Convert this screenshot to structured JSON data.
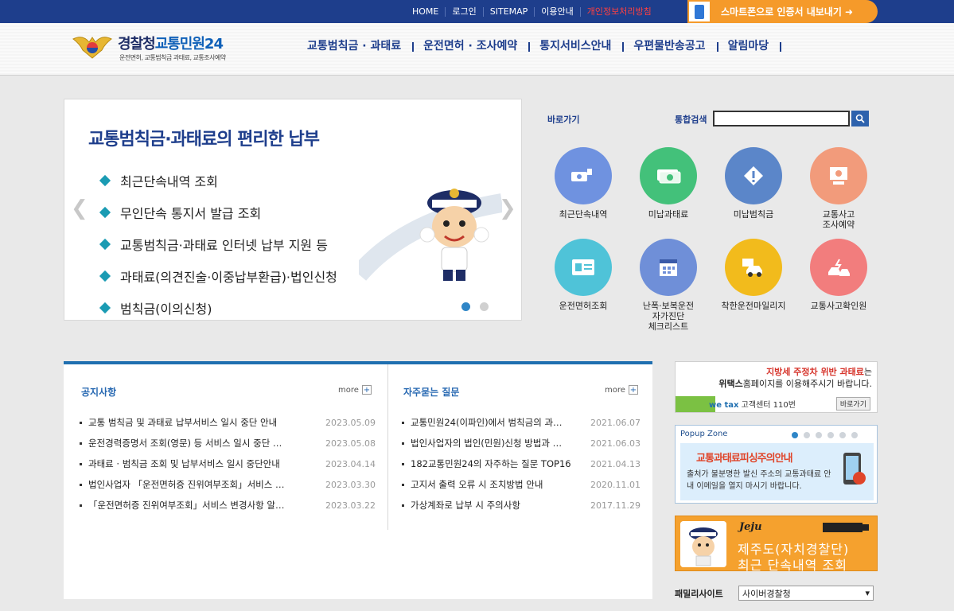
{
  "topbar": {
    "links": [
      "HOME",
      "로그인",
      "SITEMAP",
      "이용안내",
      "개인정보처리방침"
    ],
    "smart_label": "스마트폰으로 인증서 내보내기 ➜"
  },
  "logo": {
    "title_a": "경찰청",
    "title_b": "교통민원24",
    "subtitle": "운전면허, 교통범칙금 과태료, 교통조사예약"
  },
  "nav": [
    "교통범칙금 · 과태료",
    "운전면허 · 조사예약",
    "통지서비스안내",
    "우편물반송공고",
    "알림마당"
  ],
  "visual": {
    "title": "교통범칙금·과태료의 편리한 납부",
    "items": [
      "최근단속내역 조회",
      "무인단속 통지서 발급 조회",
      "교통범칙금·과태료 인터넷 납부 지원 등",
      "과태료(의견진술·이중납부환급)·법인신청",
      "범칙금(이의신청)"
    ],
    "prev_arrow": "❮",
    "next_arrow": "❯",
    "slide": "1 / 2"
  },
  "quick": {
    "title": "바로가기",
    "search_label": "통합검색",
    "search_value": "",
    "items": [
      {
        "label": "최근단속내역",
        "color": "#6f92e0",
        "icon": "camera-icon"
      },
      {
        "label": "미납과태료",
        "color": "#43c17a",
        "icon": "money-icon"
      },
      {
        "label": "미납범칙금",
        "color": "#5b86c9",
        "icon": "warning-icon"
      },
      {
        "label": "교통사고\n조사예약",
        "color": "#f29b7b",
        "icon": "monitor-icon"
      },
      {
        "label": "운전면허조회",
        "color": "#4fc3d8",
        "icon": "license-icon"
      },
      {
        "label": "난폭·보복운전\n자가진단\n체크리스트",
        "color": "#6f8fd8",
        "icon": "calendar-icon"
      },
      {
        "label": "착한운전마일리지",
        "color": "#f2bb1c",
        "icon": "car-icon"
      },
      {
        "label": "교통사고확인원",
        "color": "#f27d7d",
        "icon": "crash-icon"
      }
    ]
  },
  "notice": {
    "title": "공지사항",
    "more": "more",
    "items": [
      {
        "title": "교통 범칙금 및 과태료 납부서비스 일시 중단 안내",
        "date": "2023.05.09"
      },
      {
        "title": "운전경력증명서 조회(영문) 등 서비스 일시 중단 …",
        "date": "2023.05.08"
      },
      {
        "title": "과태료 · 범칙금 조회 및 납부서비스 일시 중단안내",
        "date": "2023.04.14"
      },
      {
        "title": "법인사업자 「운전면허증 진위여부조회」서비스 …",
        "date": "2023.03.30"
      },
      {
        "title": "「운전면허증 진위여부조회」서비스 변경사항 알…",
        "date": "2023.03.22"
      }
    ]
  },
  "faq": {
    "title": "자주묻는 질문",
    "more": "more",
    "items": [
      {
        "title": "교통민원24(이파인)에서 범칙금의 과…",
        "date": "2021.06.07"
      },
      {
        "title": "법인사업자의 법인(민원)신청 방법과 …",
        "date": "2021.06.03"
      },
      {
        "title": "182교통민원24의 자주하는 질문 TOP16",
        "date": "2021.04.13"
      },
      {
        "title": "고지서 출력 오류 시 조치방법 안내",
        "date": "2020.11.01"
      },
      {
        "title": "가상계좌로 납부 시 주의사항",
        "date": "2017.11.29"
      }
    ]
  },
  "banner_wetax": {
    "line1_red": "지방세 주정차 위반 과태료",
    "line1_rest": "는",
    "line2_bold": "위택스",
    "line2_rest": "홈페이지를 이용해주시기 바랍니다.",
    "brand": "we tax",
    "center": "고객센터 110번",
    "button": "바로가기"
  },
  "popup": {
    "title": "Popup Zone",
    "headline": "교통과태료피싱주의안내",
    "message": "출처가 불분명한 발신 주소의 교통과태료 안내 이메일을 열지 마시기 바랍니다."
  },
  "banner_jeju": {
    "logo": "Jeju",
    "line1": "제주도(자치경찰단)",
    "line2": "최근 단속내역 조회"
  },
  "family": {
    "label": "패밀리사이트",
    "selected": "사이버경찰청"
  },
  "colors": {
    "brand_navy": "#1e3e8c",
    "accent_orange": "#f59a2a",
    "board_blue": "#1f6fb0"
  }
}
